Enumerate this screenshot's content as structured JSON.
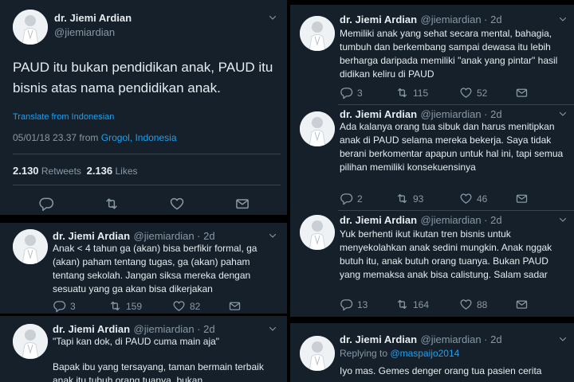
{
  "main_tweet": {
    "name": "dr. Jiemi Ardian",
    "handle": "@jiemiardian",
    "text": "PAUD itu bukan pendidikan anak, PAUD itu bisnis atas nama pendidikan anak.",
    "translate_label": "Translate from Indonesian",
    "timestamp": "05/01/18 23.37 from",
    "location": "Grogol, Indonesia",
    "retweets_count": "2.130",
    "retweets_label": "Retweets",
    "likes_count": "2.136",
    "likes_label": "Likes"
  },
  "left_replies": [
    {
      "name": "dr. Jiemi Ardian",
      "handle": "@jiemiardian · 2d",
      "text": "Anak < 4 tahun ga (akan) bisa berfikir formal, ga (akan) paham tentang tugas, ga (akan) paham tentang sekolah. Jangan siksa mereka dengan sesuatu yang ga akan bisa dikerjakan",
      "replies": "3",
      "retweets": "159",
      "likes": "82"
    },
    {
      "name": "dr. Jiemi Ardian",
      "handle": "@jiemiardian · 2d",
      "text_line1": "\"Tapi kan dok, di PAUD cuma main aja\"",
      "text_line2": "Bapak ibu yang tersayang, taman bermain terbaik anak itu tubuh orang tuanya, bukan"
    }
  ],
  "right_replies": [
    {
      "name": "dr. Jiemi Ardian",
      "handle": "@jiemiardian · 2d",
      "text": "Memiliki anak yang sehat secara mental, bahagia, tumbuh dan berkembang sampai dewasa itu lebih berharga daripada memiliki \"anak yang pintar\" hasil didikan keliru di PAUD",
      "replies": "3",
      "retweets": "115",
      "likes": "52"
    },
    {
      "name": "dr. Jiemi Ardian",
      "handle": "@jiemiardian · 2d",
      "text": "Ada kalanya orang tua sibuk dan harus menitipkan anak di PAUD selama mereka bekerja. Saya tidak berani berkomentar apapun untuk hal ini, tapi semua pilihan memiliki konsekuensinya",
      "replies": "2",
      "retweets": "93",
      "likes": "46"
    },
    {
      "name": "dr. Jiemi Ardian",
      "handle": "@jiemiardian · 2d",
      "text": "Yuk berhenti ikut ikutan tren bisnis untuk menyekolahkan anak sedini mungkin. Anak nggak butuh itu, anak butuh orang tuanya. Bukan PAUD yang memaksa anak bisa calistung. Salam sadar",
      "replies": "13",
      "retweets": "164",
      "likes": "88"
    },
    {
      "name": "dr. Jiemi Ardian",
      "handle": "@jiemiardian · 2d",
      "replying_prefix": "Replying to",
      "replying_mention": "@maspaijo2014",
      "text": "Iyo mas. Gemes denger orang tua pasien cerita"
    }
  ],
  "colors": {
    "background": "#15202b",
    "text": "#e6ecf0",
    "muted": "#8899a6",
    "accent": "#1da1f2",
    "separator": "#38444d"
  },
  "icons": [
    "reply-icon",
    "retweet-icon",
    "like-icon",
    "dm-icon",
    "chevron-down-icon"
  ]
}
